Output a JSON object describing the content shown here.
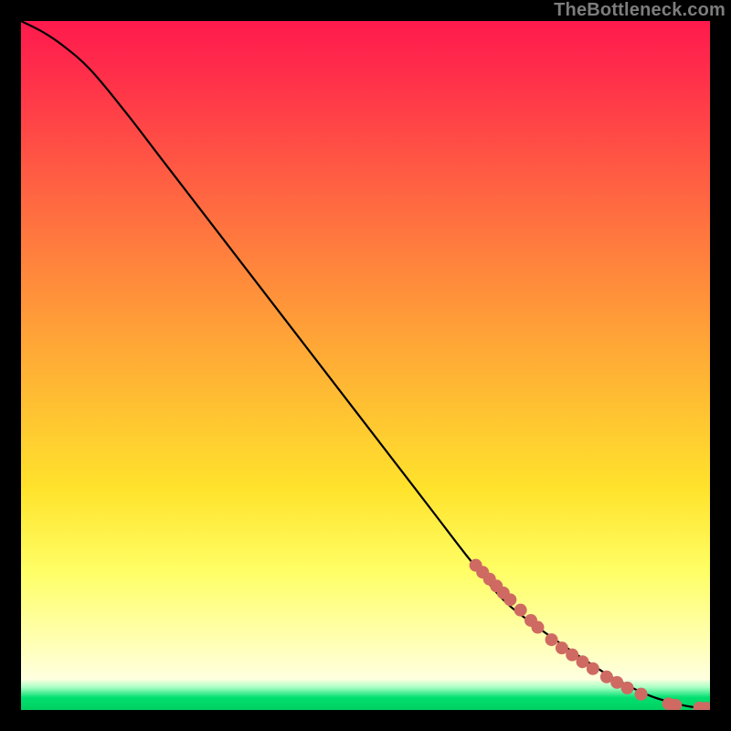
{
  "watermark": "TheBottleneck.com",
  "colors": {
    "curve_stroke": "#000000",
    "marker_fill": "#cf6a63",
    "marker_stroke": "#b45650"
  },
  "chart_data": {
    "type": "line",
    "title": "",
    "xlabel": "",
    "ylabel": "",
    "xlim": [
      0,
      100
    ],
    "ylim": [
      0,
      100
    ],
    "grid": false,
    "legend": false,
    "series": [
      {
        "name": "curve",
        "x": [
          0,
          3,
          6,
          10,
          15,
          20,
          25,
          30,
          35,
          40,
          45,
          50,
          55,
          60,
          65,
          70,
          75,
          80,
          85,
          88,
          90,
          92,
          94,
          96,
          98,
          100
        ],
        "y": [
          100,
          98.5,
          96.5,
          93,
          87,
          80.5,
          74,
          67.5,
          61,
          54.5,
          48,
          41.5,
          35,
          28.5,
          22,
          16,
          12,
          8.5,
          5.2,
          3.6,
          2.6,
          1.8,
          1.2,
          0.7,
          0.35,
          0.2
        ]
      }
    ],
    "markers": [
      {
        "x": 66,
        "y": 21
      },
      {
        "x": 67,
        "y": 20
      },
      {
        "x": 68,
        "y": 19
      },
      {
        "x": 69,
        "y": 18
      },
      {
        "x": 70,
        "y": 17
      },
      {
        "x": 71,
        "y": 16
      },
      {
        "x": 72.5,
        "y": 14.5
      },
      {
        "x": 74,
        "y": 13
      },
      {
        "x": 75,
        "y": 12
      },
      {
        "x": 77,
        "y": 10.2
      },
      {
        "x": 78.5,
        "y": 9
      },
      {
        "x": 80,
        "y": 8
      },
      {
        "x": 81.5,
        "y": 7
      },
      {
        "x": 83,
        "y": 6
      },
      {
        "x": 85,
        "y": 4.8
      },
      {
        "x": 86.5,
        "y": 4
      },
      {
        "x": 88,
        "y": 3.2
      },
      {
        "x": 90,
        "y": 2.3
      },
      {
        "x": 94,
        "y": 0.9
      },
      {
        "x": 95,
        "y": 0.7
      },
      {
        "x": 98.5,
        "y": 0.3
      },
      {
        "x": 99.5,
        "y": 0.25
      }
    ]
  }
}
